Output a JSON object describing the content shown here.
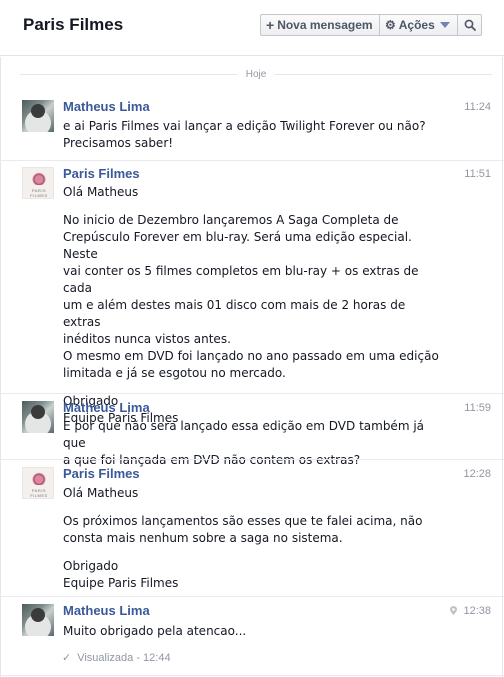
{
  "header": {
    "title": "Paris Filmes",
    "new_message_label": "Nova mensagem",
    "actions_label": "Ações"
  },
  "date_separator": "Hoje",
  "messages": [
    {
      "sender": "Matheus Lima",
      "time": "11:24",
      "avatar": "user-photo",
      "paragraphs": [
        "e ai Paris Filmes vai lançar a edição Twilight Forever ou não?\nPrecisamos saber!"
      ]
    },
    {
      "sender": "Paris Filmes",
      "time": "11:51",
      "avatar": "brand-logo",
      "brand_text": "PARIS FILMES",
      "paragraphs": [
        "Olá Matheus",
        "No inicio de Dezembro lançaremos A Saga Completa de\nCrepúsculo Forever em blu-ray. Será uma edição especial. Neste\nvai conter os 5 filmes completos em blu-ray + os extras de cada\num e além destes mais 01 disco com mais de 2 horas de extras\ninéditos nunca vistos antes.\nO mesmo em DVD foi lançado no ano passado em uma edição\nlimitada e já se esgotou no mercado.",
        "Obrigado\nEquipe Paris Filmes"
      ]
    },
    {
      "sender": "Matheus Lima",
      "time": "11:59",
      "avatar": "user-photo",
      "paragraphs": [
        "E por que não sera lançado essa edição em DVD também já que\na que foi lançada em DVD não contem os extras?"
      ]
    },
    {
      "sender": "Paris Filmes",
      "time": "12:28",
      "avatar": "brand-logo",
      "brand_text": "PARIS FILMES",
      "paragraphs": [
        "Olá Matheus",
        "Os próximos lançamentos são esses que te falei acima, não\nconsta mais nenhum sobre a saga no sistema.",
        "Obrigado\nEquipe Paris Filmes"
      ]
    },
    {
      "sender": "Matheus Lima",
      "time": "12:38",
      "avatar": "user-photo",
      "has_location_pin": true,
      "paragraphs": [
        "Muito obrigado pela atencao..."
      ]
    }
  ],
  "seen_status": "Visualizada - 12:44",
  "icons": {
    "new_message": "plus-icon",
    "actions": "gear-icon",
    "search": "search-icon",
    "location": "location-pin-icon",
    "seen": "check-icon"
  },
  "colors": {
    "sender_name": "#3b5998",
    "timestamp": "#9197a3",
    "dropdown_caret": "#6d84b4"
  }
}
